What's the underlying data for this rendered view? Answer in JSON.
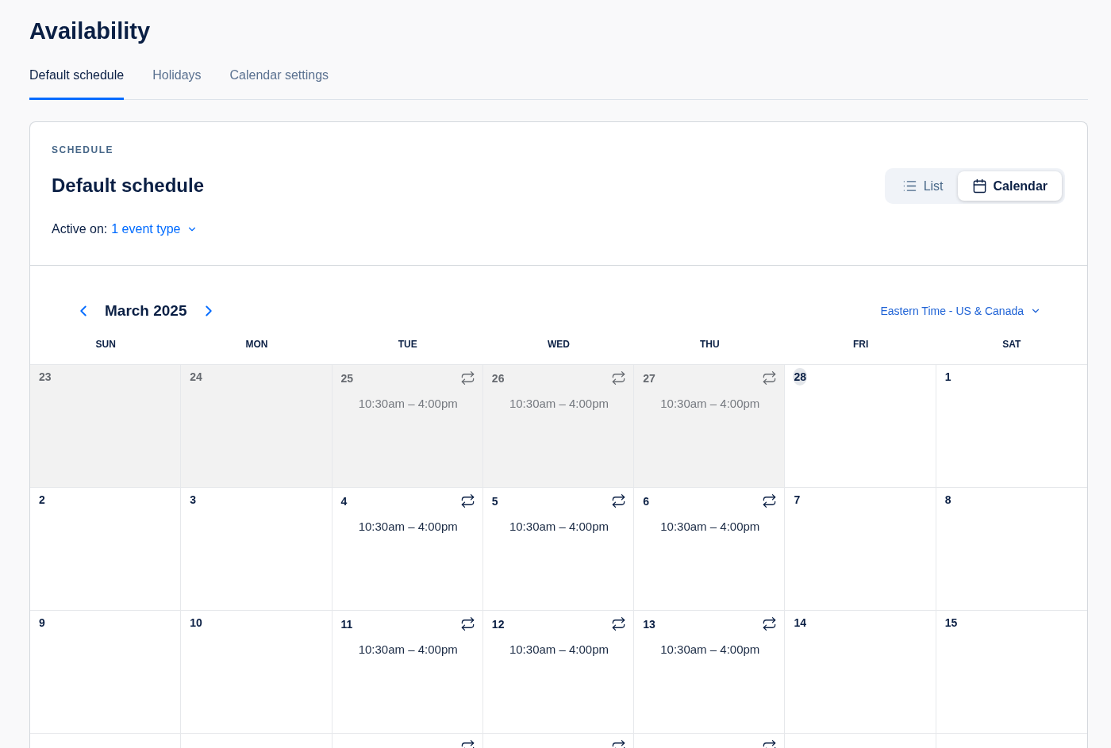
{
  "title": "Availability",
  "tabs": [
    {
      "label": "Default schedule",
      "selected": true
    },
    {
      "label": "Holidays",
      "selected": false
    },
    {
      "label": "Calendar settings",
      "selected": false
    }
  ],
  "schedule": {
    "eyebrow": "SCHEDULE",
    "name": "Default schedule",
    "active_label": "Active on:",
    "active_value": "1 event type",
    "views": [
      {
        "label": "List",
        "kind": "list",
        "selected": false
      },
      {
        "label": "Calendar",
        "kind": "calendar",
        "selected": true
      }
    ]
  },
  "calendar": {
    "month": "March 2025",
    "timezone": "Eastern Time - US & Canada",
    "weekdays": [
      "SUN",
      "MON",
      "TUE",
      "WED",
      "THU",
      "FRI",
      "SAT"
    ],
    "weeks": [
      [
        {
          "day": "23",
          "past": true,
          "today": false,
          "recurring": false
        },
        {
          "day": "24",
          "past": true,
          "today": false,
          "recurring": false
        },
        {
          "day": "25",
          "past": true,
          "today": false,
          "recurring": true,
          "hours": "10:30am – 4:00pm"
        },
        {
          "day": "26",
          "past": true,
          "today": false,
          "recurring": true,
          "hours": "10:30am – 4:00pm"
        },
        {
          "day": "27",
          "past": true,
          "today": false,
          "recurring": true,
          "hours": "10:30am – 4:00pm"
        },
        {
          "day": "28",
          "past": false,
          "today": true,
          "recurring": false
        },
        {
          "day": "1",
          "past": false,
          "today": false,
          "recurring": false
        }
      ],
      [
        {
          "day": "2",
          "past": false,
          "today": false,
          "recurring": false
        },
        {
          "day": "3",
          "past": false,
          "today": false,
          "recurring": false
        },
        {
          "day": "4",
          "past": false,
          "today": false,
          "recurring": true,
          "hours": "10:30am – 4:00pm"
        },
        {
          "day": "5",
          "past": false,
          "today": false,
          "recurring": true,
          "hours": "10:30am – 4:00pm"
        },
        {
          "day": "6",
          "past": false,
          "today": false,
          "recurring": true,
          "hours": "10:30am – 4:00pm"
        },
        {
          "day": "7",
          "past": false,
          "today": false,
          "recurring": false
        },
        {
          "day": "8",
          "past": false,
          "today": false,
          "recurring": false
        }
      ],
      [
        {
          "day": "9",
          "past": false,
          "today": false,
          "recurring": false
        },
        {
          "day": "10",
          "past": false,
          "today": false,
          "recurring": false
        },
        {
          "day": "11",
          "past": false,
          "today": false,
          "recurring": true,
          "hours": "10:30am – 4:00pm"
        },
        {
          "day": "12",
          "past": false,
          "today": false,
          "recurring": true,
          "hours": "10:30am – 4:00pm"
        },
        {
          "day": "13",
          "past": false,
          "today": false,
          "recurring": true,
          "hours": "10:30am – 4:00pm"
        },
        {
          "day": "14",
          "past": false,
          "today": false,
          "recurring": false
        },
        {
          "day": "15",
          "past": false,
          "today": false,
          "recurring": false
        }
      ],
      [
        {
          "past": false,
          "recurring": false
        },
        {
          "past": false,
          "recurring": false
        },
        {
          "past": false,
          "recurring": true
        },
        {
          "past": false,
          "recurring": true
        },
        {
          "past": false,
          "recurring": true
        },
        {
          "past": false,
          "recurring": false
        },
        {
          "past": false,
          "recurring": false
        }
      ]
    ]
  }
}
